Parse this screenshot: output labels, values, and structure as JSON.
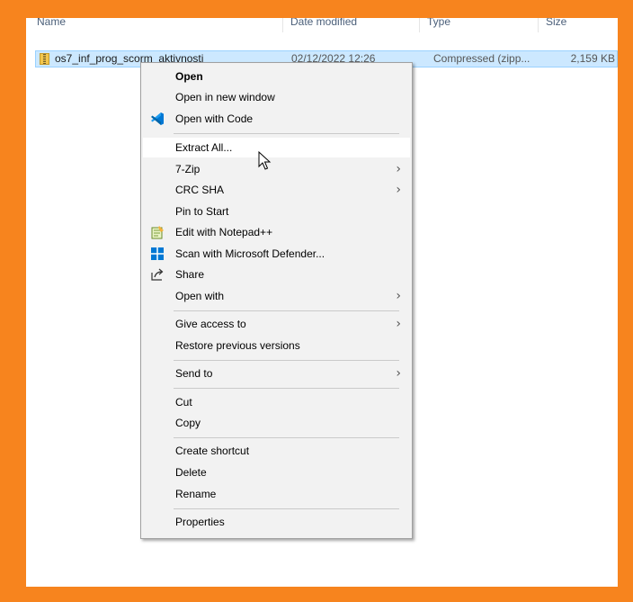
{
  "columns": {
    "name": "Name",
    "date": "Date modified",
    "type": "Type",
    "size": "Size"
  },
  "file": {
    "name": "os7_inf_prog_scorm_aktivnosti",
    "date": "02/12/2022 12:26",
    "type": "Compressed (zipp...",
    "size": "2,159 KB"
  },
  "menu": {
    "open": "Open",
    "open_new_window": "Open in new window",
    "open_with_code": "Open with Code",
    "extract_all": "Extract All...",
    "seven_zip": "7-Zip",
    "crc_sha": "CRC SHA",
    "pin_to_start": "Pin to Start",
    "edit_notepad": "Edit with Notepad++",
    "scan_defender": "Scan with Microsoft Defender...",
    "share": "Share",
    "open_with": "Open with",
    "give_access": "Give access to",
    "restore_versions": "Restore previous versions",
    "send_to": "Send to",
    "cut": "Cut",
    "copy": "Copy",
    "create_shortcut": "Create shortcut",
    "delete": "Delete",
    "rename": "Rename",
    "properties": "Properties"
  },
  "colors": {
    "frame": "#f7841e",
    "selection": "#cce8ff",
    "menu_bg": "#f2f2f2",
    "vscode_blue": "#0078d4"
  }
}
